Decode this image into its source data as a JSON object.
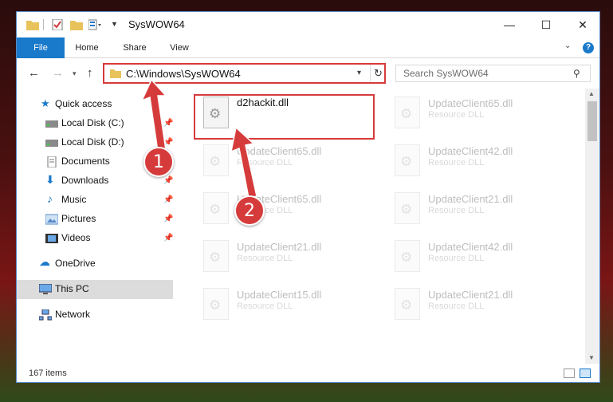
{
  "window": {
    "title": "SysWOW64",
    "controls": {
      "minimize": "—",
      "maximize": "☐",
      "close": "✕"
    }
  },
  "ribbon": {
    "tabs": [
      "File",
      "Home",
      "Share",
      "View"
    ],
    "help": "?"
  },
  "address": {
    "path": "C:\\Windows\\SysWOW64",
    "search_placeholder": "Search SysWOW64"
  },
  "sidebar": {
    "items": [
      {
        "label": "Quick access",
        "icon": "star-icon"
      },
      {
        "label": "Local Disk (C:)",
        "icon": "drive-icon",
        "pinned": true
      },
      {
        "label": "Local Disk (D:)",
        "icon": "drive-icon",
        "pinned": true
      },
      {
        "label": "Documents",
        "icon": "documents-icon",
        "pinned": true
      },
      {
        "label": "Downloads",
        "icon": "downloads-icon",
        "pinned": true
      },
      {
        "label": "Music",
        "icon": "music-icon",
        "pinned": true
      },
      {
        "label": "Pictures",
        "icon": "pictures-icon",
        "pinned": true
      },
      {
        "label": "Videos",
        "icon": "videos-icon",
        "pinned": true
      },
      {
        "label": "OneDrive",
        "icon": "onedrive-icon"
      },
      {
        "label": "This PC",
        "icon": "computer-icon",
        "selected": true
      },
      {
        "label": "Network",
        "icon": "network-icon"
      }
    ]
  },
  "files": [
    {
      "name": "d2hackit.dll",
      "type": "",
      "highlighted": true
    },
    {
      "name": "UpdateClient65.dll",
      "type": "Resource DLL"
    },
    {
      "name": "UpdateClient65.dll",
      "type": "Resource DLL"
    },
    {
      "name": "UpdateClient42.dll",
      "type": "Resource DLL"
    },
    {
      "name": "UpdateClient65.dll",
      "type": "Resource DLL"
    },
    {
      "name": "UpdateClient21.dll",
      "type": "Resource DLL"
    },
    {
      "name": "UpdateClient21.dll",
      "type": "Resource DLL"
    },
    {
      "name": "UpdateClient42.dll",
      "type": "Resource DLL"
    },
    {
      "name": "UpdateClient15.dll",
      "type": "Resource DLL"
    },
    {
      "name": "UpdateClient21.dll",
      "type": "Resource DLL"
    }
  ],
  "status": {
    "item_count": "167 items"
  },
  "annotations": {
    "step1": "1",
    "step2": "2"
  },
  "colors": {
    "accent": "#1979ca",
    "annotation": "#d63b3b"
  }
}
